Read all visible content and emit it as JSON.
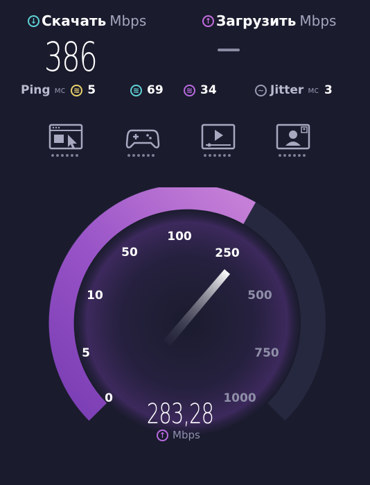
{
  "download": {
    "label": "Скачать",
    "unit": "Mbps",
    "value": "386"
  },
  "upload": {
    "label": "Загрузить",
    "unit": "Mbps"
  },
  "stats": {
    "ping_label": "Ping",
    "ping_unit": "мс",
    "ping_value": "5",
    "download_ping": "69",
    "upload_ping": "34",
    "jitter_label": "Jitter",
    "jitter_unit": "мс",
    "jitter_value": "3"
  },
  "icons": [
    "browsing-icon",
    "gaming-icon",
    "video-icon",
    "video-call-icon"
  ],
  "gauge": {
    "ticks": [
      "0",
      "5",
      "10",
      "50",
      "100",
      "250",
      "500",
      "750",
      "1000"
    ],
    "current_speed": "283,28",
    "unit": "Mbps",
    "colors": {
      "active_start": "#7c3fb5",
      "active_end": "#c880d8",
      "inactive": "#26283f"
    }
  }
}
